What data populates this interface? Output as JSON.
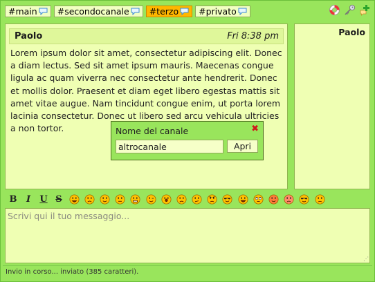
{
  "tabs": [
    {
      "label": "#main",
      "active": false
    },
    {
      "label": "#secondocanale",
      "active": false
    },
    {
      "label": "#terzo",
      "active": true
    },
    {
      "label": "#privato",
      "active": false
    }
  ],
  "top_icons": [
    "lifebuoy-icon",
    "key-icon",
    "add-channel-icon"
  ],
  "message": {
    "nick": "Paolo",
    "time": "Fri 8:38 pm",
    "text": "Lorem ipsum dolor sit amet, consectetur adipiscing elit. Donec a diam lectus. Sed sit amet ipsum mauris. Maecenas congue ligula ac quam viverra nec consectetur ante hendrerit. Donec et mollis dolor. Praesent et diam eget libero egestas mattis sit amet vitae augue. Nam tincidunt congue enim, ut porta lorem lacinia consectetur. Donec ut libero sed arcu vehicula ultricies a non tortor."
  },
  "users": [
    "Paolo"
  ],
  "popup": {
    "title": "Nome del canale",
    "close_symbol": "✖",
    "input_value": "altrocanale",
    "button_label": "Apri"
  },
  "format_buttons": [
    {
      "name": "bold-button",
      "label": "B"
    },
    {
      "name": "italic-button",
      "label": "I"
    },
    {
      "name": "underline-button",
      "label": "U"
    },
    {
      "name": "strikethrough-button",
      "label": "S"
    }
  ],
  "smileys": [
    "grin",
    "sad",
    "smile",
    "neutral",
    "teeth",
    "wink",
    "shocked",
    "frown",
    "confused",
    "angry",
    "cool",
    "laugh",
    "eyes-rolling",
    "devil",
    "red-face",
    "sunglasses",
    "worried"
  ],
  "colors": {
    "background": "#99e55c",
    "panel": "#efffb3",
    "active_tab": "#ffb700",
    "smiley_face": "#ffc200"
  },
  "composer": {
    "placeholder": "Scrivi qui il tuo messaggio..."
  },
  "status": {
    "text": "Invio in corso... inviato (385 caratteri)."
  }
}
